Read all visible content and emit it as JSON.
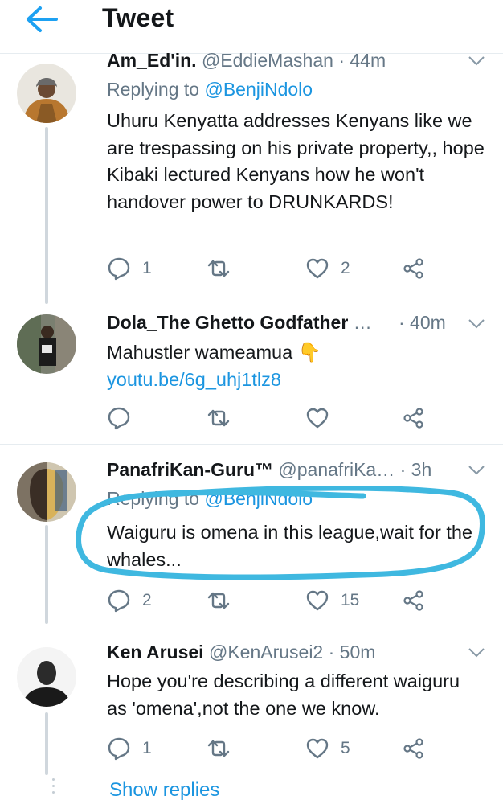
{
  "header": {
    "title": "Tweet"
  },
  "tweets": [
    {
      "name": "Am_Ed'in.",
      "handle": "@EddieMashan",
      "time": "· 44m",
      "replying_prefix": "Replying to ",
      "replying_handle": "@BenjiNdolo",
      "text": "Uhuru Kenyatta addresses Kenyans like we are trespassing on his private property,, hope Kibaki lectured Kenyans how he won't handover power to DRUNKARDS!",
      "replies": "1",
      "retweets": "",
      "likes": "2"
    },
    {
      "name": "Dola_The Ghetto Godfather",
      "handle": "…",
      "time": "· 40m",
      "text": "Mahustler wameamua 👇",
      "link": "youtu.be/6g_uhj1tlz8",
      "replies": "",
      "retweets": "",
      "likes": ""
    },
    {
      "name": "PanafriKan-Guru™",
      "handle": "@panafriKa…",
      "time": "· 3h",
      "replying_prefix": "Replying to ",
      "replying_handle": "@BenjiNdolo",
      "text": "Waiguru is omena in this league,wait for the whales...",
      "replies": "2",
      "retweets": "",
      "likes": "15"
    },
    {
      "name": "Ken Arusei",
      "handle": "@KenArusei2",
      "time": "· 50m",
      "text": "Hope you're describing a different waiguru as 'omena',not the one we know.",
      "replies": "1",
      "retweets": "",
      "likes": "5"
    }
  ],
  "show_replies": "Show replies",
  "colors": {
    "accent": "#1da1f2",
    "link": "#1b95e0",
    "muted": "#657786",
    "highlight": "#3fb8e0"
  }
}
